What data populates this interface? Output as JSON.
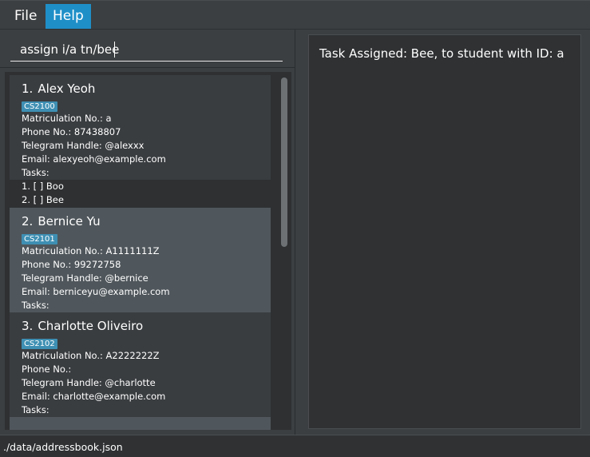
{
  "menubar": {
    "items": [
      {
        "label": "File"
      },
      {
        "label": "Help"
      }
    ]
  },
  "command": {
    "value": "assign i/a tn/bee"
  },
  "persons": [
    {
      "index": "1.",
      "name": "Alex Yeoh",
      "tag": "CS2100",
      "lines": [
        "Matriculation No.: a",
        "Phone No.: 87438807",
        "Telegram Handle: @alexxx",
        "Email: alexyeoh@example.com",
        "Tasks:",
        "1. [ ] Boo",
        "2. [ ] Bee"
      ]
    },
    {
      "index": "2.",
      "name": "Bernice Yu",
      "tag": "CS2101",
      "lines": [
        "Matriculation No.: A1111111Z",
        "Phone No.: 99272758",
        "Telegram Handle: @bernice",
        "Email: berniceyu@example.com",
        "Tasks:"
      ]
    },
    {
      "index": "3.",
      "name": "Charlotte Oliveiro",
      "tag": "CS2102",
      "lines": [
        "Matriculation No.: A2222222Z",
        "Phone No.:",
        "Telegram Handle: @charlotte",
        "Email: charlotte@example.com",
        "Tasks:"
      ]
    }
  ],
  "result": {
    "text": "Task Assigned: Bee, to student with ID: a"
  },
  "status": {
    "path": "./data/addressbook.json"
  },
  "colors": {
    "accent": "#1f8fc8",
    "tag": "#3e8fb3",
    "selected_card": "#50575c"
  }
}
